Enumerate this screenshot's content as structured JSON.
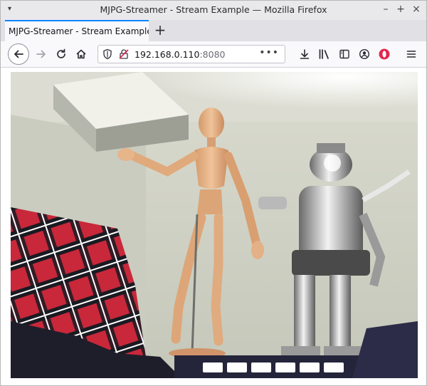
{
  "window": {
    "title": "MJPG-Streamer - Stream Example — Mozilla Firefox",
    "menu_arrow": "▾",
    "minimize": "–",
    "maximize": "+",
    "close": "×"
  },
  "tabs": [
    {
      "label": "MJPG-Streamer - Stream Example"
    }
  ],
  "new_tab_label": "+",
  "address_bar": {
    "host": "192.168.0.110",
    "port": ":8080",
    "more": "•••"
  },
  "stream": {
    "description_icon": "mjpg-stream-frame"
  },
  "colors": {
    "accent": "#0a84ff",
    "red_badge": "#e22850"
  }
}
